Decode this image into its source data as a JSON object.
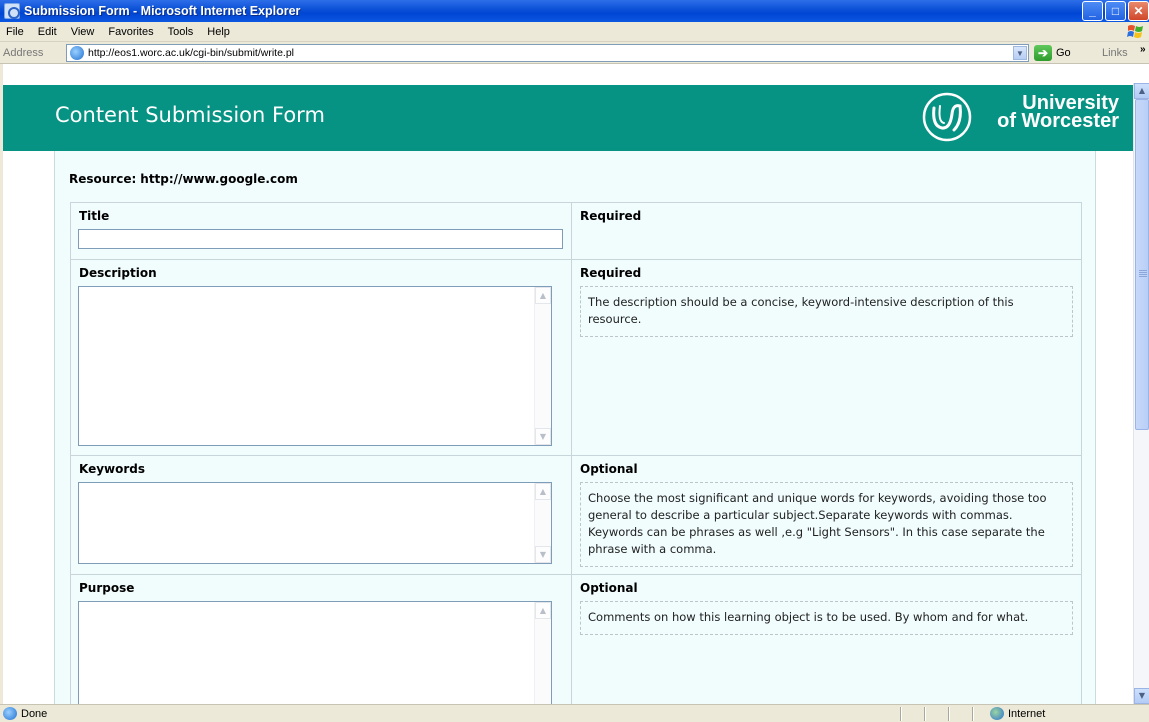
{
  "window": {
    "title": "Submission Form - Microsoft Internet Explorer",
    "buttons": {
      "minimize": "_",
      "maximize": "□",
      "close": "✕"
    }
  },
  "menu": [
    "File",
    "Edit",
    "View",
    "Favorites",
    "Tools",
    "Help"
  ],
  "address_bar": {
    "label": "Address",
    "url": "http://eos1.worc.ac.uk/cgi-bin/submit/write.pl",
    "go_label": "Go",
    "links_label": "Links"
  },
  "header": {
    "page_title": "Content Submission Form",
    "org_name_line1": "University",
    "org_name_line2": "of Worcester"
  },
  "resource": {
    "label": "Resource:",
    "url": "http://www.google.com"
  },
  "fields": [
    {
      "label": "Title",
      "status": "Required",
      "help": "",
      "value": ""
    },
    {
      "label": "Description",
      "status": "Required",
      "help": "The description should be a concise, keyword-intensive description of this resource.",
      "value": ""
    },
    {
      "label": "Keywords",
      "status": "Optional",
      "help": "Choose the most significant and unique words for keywords, avoiding those too general to describe a particular subject.Separate keywords with commas. Keywords can be phrases as well ,e.g \"Light Sensors\". In this case separate the phrase with a comma.",
      "value": ""
    },
    {
      "label": "Purpose",
      "status": "Optional",
      "help": "Comments on how this learning object is to be used. By whom and for what.",
      "value": ""
    }
  ],
  "status_bar": {
    "status": "Done",
    "zone": "Internet"
  },
  "colors": {
    "header_bg": "#069383",
    "content_bg": "#f1fcfd",
    "xp_title_blue": "#0046d5"
  }
}
